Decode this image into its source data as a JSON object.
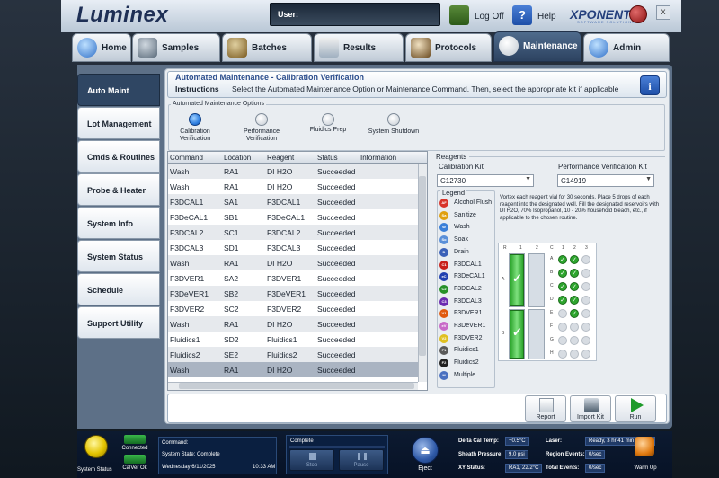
{
  "app": {
    "logo": "Luminex",
    "brand": "XPONENT",
    "brand_sub": "SOFTWARE SOLUTIONS"
  },
  "header": {
    "user_label": "User:",
    "logoff": "Log Off",
    "help": "Help",
    "close": "x"
  },
  "tabs": [
    {
      "label": "Home"
    },
    {
      "label": "Samples"
    },
    {
      "label": "Batches"
    },
    {
      "label": "Results"
    },
    {
      "label": "Protocols"
    },
    {
      "label": "Maintenance"
    },
    {
      "label": "Admin"
    }
  ],
  "sidebar": {
    "items": [
      {
        "label": "Auto Maint"
      },
      {
        "label": "Lot Management"
      },
      {
        "label": "Cmds & Routines"
      },
      {
        "label": "Probe & Heater"
      },
      {
        "label": "System Info"
      },
      {
        "label": "System Status"
      },
      {
        "label": "Schedule"
      },
      {
        "label": "Support Utility"
      }
    ]
  },
  "panel": {
    "title": "Automated Maintenance - Calibration Verification",
    "instructions_label": "Instructions",
    "instructions_text": "Select the Automated Maintenance Option or Maintenance Command. Then, select the appropriate kit if applicable",
    "options_legend": "Automated Maintenance Options",
    "options": [
      {
        "label": "Calibration Verification",
        "selected": true
      },
      {
        "label": "Performance Verification",
        "selected": false
      },
      {
        "label": "Fluidics Prep",
        "selected": false
      },
      {
        "label": "System Shutdown",
        "selected": false
      }
    ]
  },
  "table": {
    "headers": [
      "Command",
      "Location",
      "Reagent",
      "Status",
      "Information"
    ],
    "rows": [
      [
        "Wash",
        "RA1",
        "DI H2O",
        "Succeeded",
        ""
      ],
      [
        "Wash",
        "RA1",
        "DI H2O",
        "Succeeded",
        ""
      ],
      [
        "F3DCAL1",
        "SA1",
        "F3DCAL1",
        "Succeeded",
        ""
      ],
      [
        "F3DeCAL1",
        "SB1",
        "F3DeCAL1",
        "Succeeded",
        ""
      ],
      [
        "F3DCAL2",
        "SC1",
        "F3DCAL2",
        "Succeeded",
        ""
      ],
      [
        "F3DCAL3",
        "SD1",
        "F3DCAL3",
        "Succeeded",
        ""
      ],
      [
        "Wash",
        "RA1",
        "DI H2O",
        "Succeeded",
        ""
      ],
      [
        "F3DVER1",
        "SA2",
        "F3DVER1",
        "Succeeded",
        ""
      ],
      [
        "F3DeVER1",
        "SB2",
        "F3DeVER1",
        "Succeeded",
        ""
      ],
      [
        "F3DVER2",
        "SC2",
        "F3DVER2",
        "Succeeded",
        ""
      ],
      [
        "Wash",
        "RA1",
        "DI H2O",
        "Succeeded",
        ""
      ],
      [
        "Fluidics1",
        "SD2",
        "Fluidics1",
        "Succeeded",
        ""
      ],
      [
        "Fluidics2",
        "SE2",
        "Fluidics2",
        "Succeeded",
        ""
      ],
      [
        "Wash",
        "RA1",
        "DI H2O",
        "Succeeded",
        ""
      ]
    ]
  },
  "reagents": {
    "title": "Reagents",
    "calibration_kit_label": "Calibration Kit",
    "calibration_kit_value": "C12730",
    "performance_kit_label": "Performance Verification Kit",
    "performance_kit_value": "C14919",
    "legend_title": "Legend",
    "legend": [
      {
        "abbr": "AF",
        "label": "Alcohol Flush",
        "color": "#d8342a"
      },
      {
        "abbr": "Sa",
        "label": "Sanitize",
        "color": "#e0a010"
      },
      {
        "abbr": "W",
        "label": "Wash",
        "color": "#3a7fd8"
      },
      {
        "abbr": "So",
        "label": "Soak",
        "color": "#5a8fd8"
      },
      {
        "abbr": "D",
        "label": "Drain",
        "color": "#3a60b8"
      },
      {
        "abbr": "C1",
        "label": "F3DCAL1",
        "color": "#c8201a"
      },
      {
        "abbr": "eC",
        "label": "F3DeCAL1",
        "color": "#2040b0"
      },
      {
        "abbr": "C2",
        "label": "F3DCAL2",
        "color": "#28902a"
      },
      {
        "abbr": "C3",
        "label": "F3DCAL3",
        "color": "#6a2ab0"
      },
      {
        "abbr": "V1",
        "label": "F3DVER1",
        "color": "#e05a10"
      },
      {
        "abbr": "eV",
        "label": "F3DeVER1",
        "color": "#c86ac8"
      },
      {
        "abbr": "V2",
        "label": "F3DVER2",
        "color": "#e0c020"
      },
      {
        "abbr": "F1",
        "label": "Fluidics1",
        "color": "#5a5a5a"
      },
      {
        "abbr": "F2",
        "label": "Fluidics2",
        "color": "#202020"
      },
      {
        "abbr": "M",
        "label": "Multiple",
        "color": "#4a70c0"
      }
    ],
    "instruction": "Vortex each reagent vial for 30 seconds. Place 5 drops of each reagent into the designated well. Fill the designated reservoirs with DI H2O, 70% Isopropanol, 10 - 20% household bleach, etc., if applicable to the chosen routine.",
    "plate": {
      "reservoir_cols": [
        "R",
        "1",
        "2"
      ],
      "well_cols": [
        "C",
        "1",
        "2",
        "3"
      ],
      "rows": [
        "A",
        "B",
        "C",
        "D",
        "E",
        "F",
        "G",
        "H"
      ],
      "reservoir_labels": [
        "A",
        "B"
      ]
    }
  },
  "actions": [
    {
      "label": "Report"
    },
    {
      "label": "Import Kit"
    },
    {
      "label": "Run"
    }
  ],
  "status": {
    "system_status": "System Status",
    "connected": "Connected",
    "calver": "CalVer Ok",
    "command_label": "Command:",
    "system_state_label": "System State:",
    "system_state": "Complete",
    "date": "Wednesday 6/11/2025",
    "time": "10:33 AM",
    "progress_label": "Complete",
    "stop": "Stop",
    "pause": "Pause",
    "eject": "Eject",
    "delta_cal_temp_label": "Delta Cal Temp:",
    "delta_cal_temp": "+0.5°C",
    "sheath_pressure_label": "Sheath Pressure:",
    "sheath_pressure": "9.0 psi",
    "xy_status_label": "XY Status:",
    "xy_status": "RA1, 22.2°C",
    "laser_label": "Laser:",
    "laser": "Ready, 3 hr 41 min remain",
    "region_events_label": "Region Events:",
    "region_events": "0/sec",
    "total_events_label": "Total Events:",
    "total_events": "0/sec",
    "warmup": "Warm Up"
  }
}
